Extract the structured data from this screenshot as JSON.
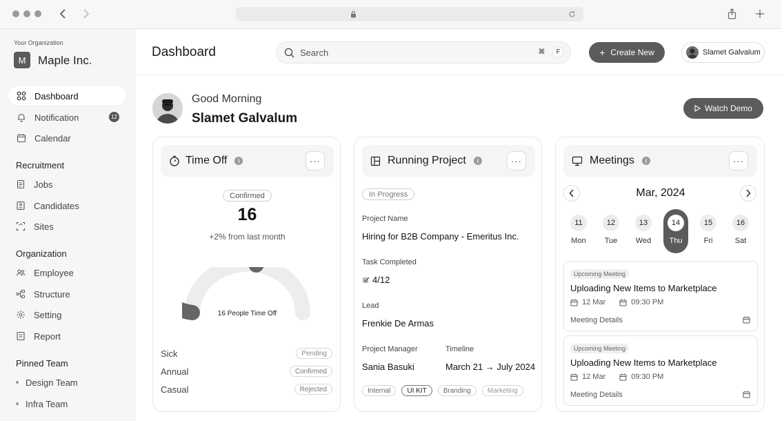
{
  "browser": {
    "lock_icon": "lock-icon",
    "reload_icon": "reload-icon"
  },
  "sidebar": {
    "org_label": "Your Organization",
    "org_initial": "M",
    "org_name": "Maple Inc.",
    "nav": [
      {
        "label": "Dashboard",
        "icon": "grid-icon"
      },
      {
        "label": "Notification",
        "icon": "bell-icon",
        "badge": "12"
      },
      {
        "label": "Calendar",
        "icon": "calendar-icon"
      }
    ],
    "recruitment": {
      "title": "Recruitment",
      "items": [
        "Jobs",
        "Candidates",
        "Sites"
      ]
    },
    "organization": {
      "title": "Organization",
      "items": [
        "Employee",
        "Structure",
        "Setting",
        "Report"
      ]
    },
    "pinned": {
      "title": "Pinned Team",
      "items": [
        "Design Team",
        "Infra Team"
      ]
    }
  },
  "header": {
    "title": "Dashboard",
    "search_placeholder": "Search",
    "shortcut_cmd": "⌘",
    "shortcut_key": "F",
    "create_label": "Create New",
    "user_name": "Slamet Galvalum"
  },
  "greeting": {
    "line1": "Good Morning",
    "name": "Slamet Galvalum",
    "watch_label": "Watch Demo"
  },
  "time_off": {
    "title": "Time Off",
    "status": "Confirmed",
    "count": "16",
    "change": "+2% from last month",
    "gauge_label": "16 People Time Off",
    "gauge_fraction": 0.55,
    "rows": [
      {
        "label": "Sick",
        "status": "Pending"
      },
      {
        "label": "Annual",
        "status": "Confirmed"
      },
      {
        "label": "Casual",
        "status": "Rejected"
      }
    ]
  },
  "project": {
    "title": "Running Project",
    "status": "In Progress",
    "name_label": "Project Name",
    "name": "Hiring for B2B Company - Emeritus Inc.",
    "task_label": "Task Completed",
    "task_value": "4/12",
    "lead_label": "Lead",
    "lead": "Frenkie De Armas",
    "pm_label": "Project Manager",
    "pm": "Sania Basuki",
    "timeline_label": "Timeline",
    "timeline": "March 21 → July 2024",
    "tags": [
      "Internal",
      "UI KIT",
      "Branding",
      "Marketing"
    ]
  },
  "meetings": {
    "title": "Meetings",
    "month": "Mar, 2024",
    "days": [
      {
        "num": "11",
        "name": "Mon"
      },
      {
        "num": "12",
        "name": "Tue"
      },
      {
        "num": "13",
        "name": "Wed"
      },
      {
        "num": "14",
        "name": "Thu"
      },
      {
        "num": "15",
        "name": "Fri"
      },
      {
        "num": "16",
        "name": "Sat"
      }
    ],
    "selected_day": "14",
    "items": [
      {
        "tag": "Upcoming Meeting",
        "title": "Uploading New Items to Marketplace",
        "date": "12 Mar",
        "time": "09:30 PM",
        "link": "Meeting Details"
      },
      {
        "tag": "Upcoming Meeting",
        "title": "Uploading New Items to Marketplace",
        "date": "12 Mar",
        "time": "09:30 PM",
        "link": "Meeting Details"
      }
    ]
  },
  "colors": {
    "accent": "#5b5b5b",
    "gauge_fill": "#666666",
    "gauge_track": "#ededed"
  }
}
